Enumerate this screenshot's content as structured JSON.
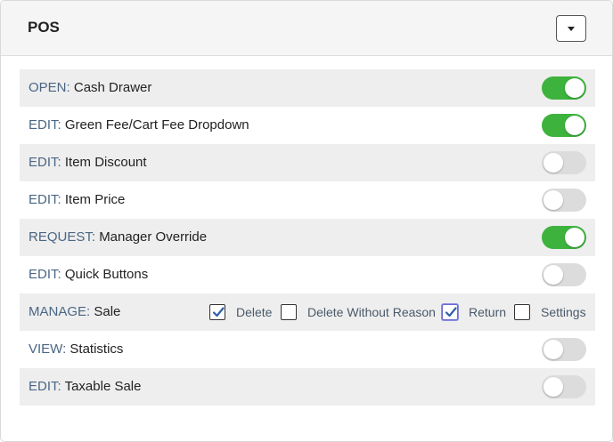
{
  "panel": {
    "title": "POS",
    "dropdown_icon": "caret-down-icon"
  },
  "permissions": [
    {
      "verb": "OPEN:",
      "name": "Cash Drawer",
      "enabled": true
    },
    {
      "verb": "EDIT:",
      "name": "Green Fee/Cart Fee Dropdown",
      "enabled": true
    },
    {
      "verb": "EDIT:",
      "name": "Item Discount",
      "enabled": false
    },
    {
      "verb": "EDIT:",
      "name": "Item Price",
      "enabled": false
    },
    {
      "verb": "REQUEST:",
      "name": "Manager Override",
      "enabled": true
    },
    {
      "verb": "EDIT:",
      "name": "Quick Buttons",
      "enabled": false
    },
    {
      "verb": "MANAGE:",
      "name": "Sale",
      "options": [
        {
          "label": "Delete",
          "checked": true
        },
        {
          "label": "Delete Without Reason",
          "checked": false
        },
        {
          "label": "Return",
          "checked": true
        },
        {
          "label": "Settings",
          "checked": false
        }
      ]
    },
    {
      "verb": "VIEW:",
      "name": "Statistics",
      "enabled": false
    },
    {
      "verb": "EDIT:",
      "name": "Taxable Sale",
      "enabled": false
    }
  ],
  "colors": {
    "toggle_on": "#3db33d",
    "toggle_off": "#dcdcdc",
    "verb_text": "#4a6684"
  }
}
